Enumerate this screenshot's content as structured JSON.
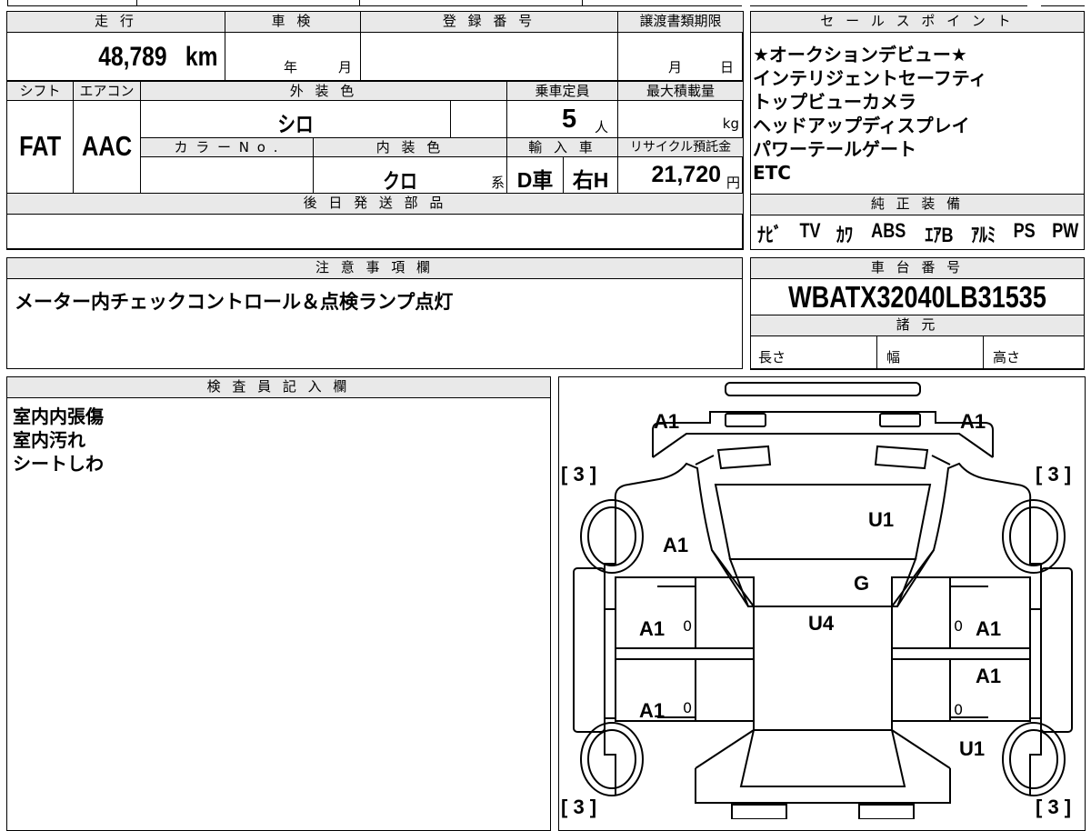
{
  "top": {
    "mileage_label": "走 行",
    "shaken_label": "車 検",
    "reg_label": "登 録 番 号",
    "transfer_label": "譲渡書類期限",
    "mileage": "48,789",
    "mileage_unit": "km",
    "year_mark": "年",
    "month_mark": "月",
    "day_mark": "日",
    "shift_label": "シフト",
    "ac_label": "エアコン",
    "exterior_label": "外 装 色",
    "capacity_label": "乗車定員",
    "maxload_label": "最大積載量",
    "shift": "FAT",
    "ac": "AAC",
    "exterior": "シロ",
    "capacity": "5",
    "capacity_unit": "人",
    "maxload_unit": "kg",
    "colorno_label": "カ ラ ー N o .",
    "interior_label": "内 装 色",
    "import_label": "輸 入 車",
    "recycle_label": "リサイクル預託金",
    "interior": "クロ",
    "interior_suffix": "系",
    "import_type": "D車",
    "steering": "右H",
    "recycle_fee": "21,720",
    "recycle_unit": "円",
    "later_parts_label": "後 日 発 送 部 品"
  },
  "sales": {
    "label": "セ ー ル ス ポ イ ン ト",
    "lines": [
      "★オークションデビュー★",
      "インテリジェントセーフティ",
      "トップビューカメラ",
      "ヘッドアップディスプレイ",
      "パワーテールゲート",
      "ETC"
    ]
  },
  "equipment": {
    "label": "純 正 装 備",
    "items": [
      "ﾅﾋﾞ",
      "TV",
      "ｶﾜ",
      "ABS",
      "ｴｱB",
      "ｱﾙﾐ",
      "PS",
      "PW"
    ]
  },
  "notes": {
    "label": "注 意 事 項 欄",
    "text": "メーター内チェックコントロール＆点検ランプ点灯"
  },
  "chassis": {
    "label": "車 台 番 号",
    "number": "WBATX32040LB31535",
    "specs_label": "諸 元",
    "length_label": "長さ",
    "width_label": "幅",
    "height_label": "高さ"
  },
  "inspector": {
    "label": "検 査 員 記 入 欄",
    "lines": [
      "室内内張傷",
      "室内汚れ",
      "シートしわ"
    ]
  },
  "diagram": {
    "marks": {
      "front_left": "A1",
      "front_right": "A1",
      "tire_fl": "[ 3 ]",
      "tire_fr": "[ 3 ]",
      "tire_rl": "[ 3 ]",
      "tire_rr": "[ 3 ]",
      "fender_l": "A1",
      "hood": "U1",
      "windshield": "G",
      "roof": "U4",
      "door_fl": "A1",
      "door_rl": "A1",
      "door_fr": "A1",
      "door_rr": "A1",
      "quarter_r": "U1",
      "zero_fl": "0",
      "zero_rl": "0",
      "zero_fr": "0",
      "zero_rr": "0"
    }
  }
}
